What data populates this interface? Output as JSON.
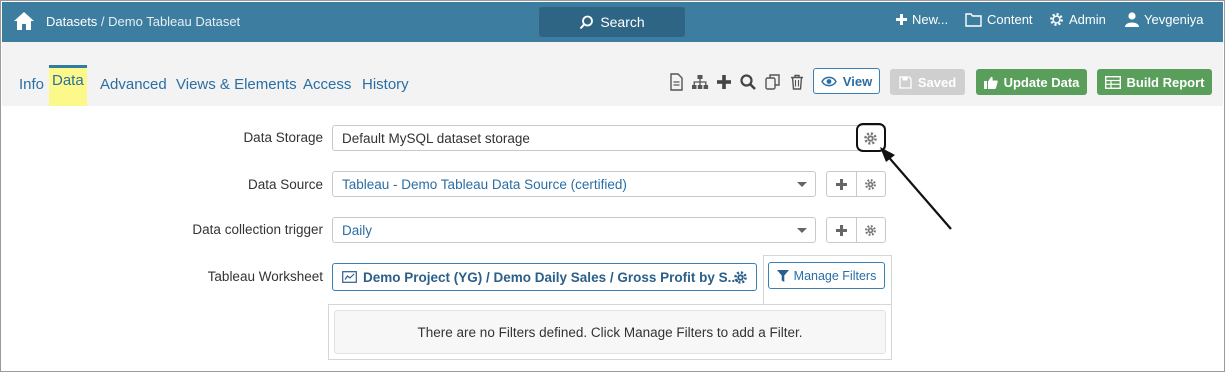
{
  "topbar": {
    "breadcrumb": {
      "root": "Datasets",
      "separator": " / ",
      "current": "Demo Tableau Dataset"
    },
    "search_label": "Search",
    "new_label": "New...",
    "content_label": "Content",
    "admin_label": "Admin",
    "user_label": "Yevgeniya",
    "background_color": "#3d7ea0"
  },
  "tabs": [
    {
      "label": "Info"
    },
    {
      "label": "Data",
      "active": true
    },
    {
      "label": "Advanced"
    },
    {
      "label": "Views & Elements"
    },
    {
      "label": "Access"
    },
    {
      "label": "History"
    }
  ],
  "toolbar": {
    "icons": [
      "document-icon",
      "hierarchy-icon",
      "plus-icon",
      "search-icon",
      "copy-icon",
      "trash-icon"
    ],
    "view_label": "View",
    "saved_label": "Saved",
    "update_label": "Update Data",
    "build_label": "Build Report",
    "green_color": "#5a9e5c"
  },
  "form": {
    "storage_label": "Data Storage",
    "storage_value": "Default MySQL dataset storage",
    "source_label": "Data Source",
    "source_value": "Tableau - Demo Tableau Data Source (certified)",
    "trigger_label": "Data collection trigger",
    "trigger_value": "Daily",
    "worksheet_label": "Tableau Worksheet",
    "worksheet_value": "Demo Project (YG) / Demo Daily Sales / Gross Profit by S...",
    "manage_filters_label": "Manage Filters",
    "no_filters_text": "There are no Filters defined. Click Manage Filters to add a Filter."
  }
}
